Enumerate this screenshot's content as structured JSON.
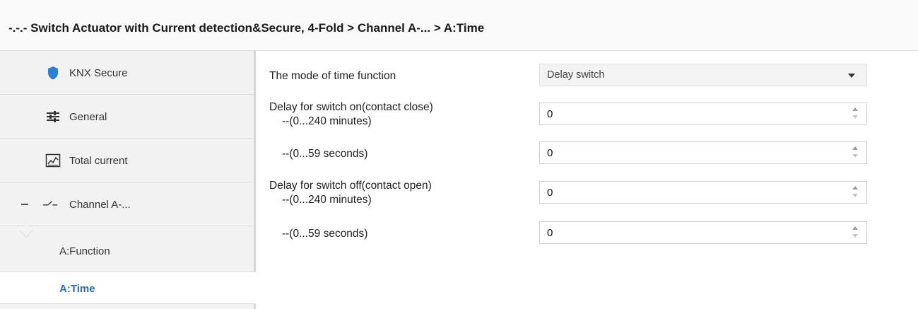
{
  "header": {
    "title": "-.-.- Switch Actuator with Current detection&Secure, 4-Fold > Channel A-... >  A:Time"
  },
  "sidebar": {
    "items": [
      {
        "label": "KNX Secure",
        "icon": "shield-icon"
      },
      {
        "label": "General",
        "icon": "sliders-icon"
      },
      {
        "label": "Total current",
        "icon": "chart-icon"
      },
      {
        "label": "Channel A-...",
        "icon": "switch-contact-icon",
        "expanded": true
      }
    ],
    "subitems": [
      {
        "label": "A:Function",
        "active": false
      },
      {
        "label": "A:Time",
        "active": true
      }
    ]
  },
  "params": {
    "mode": {
      "label": "The mode of time function",
      "value": "Delay switch"
    },
    "on_minutes": {
      "label": "Delay for switch on(contact close)",
      "sublabel": "--(0...240 minutes)",
      "value": "0"
    },
    "on_seconds": {
      "sublabel": "--(0...59 seconds)",
      "value": "0"
    },
    "off_minutes": {
      "label": "Delay for switch off(contact open)",
      "sublabel": "--(0...240 minutes)",
      "value": "0"
    },
    "off_seconds": {
      "sublabel": "--(0...59 seconds)",
      "value": "0"
    }
  },
  "colors": {
    "accent": "#2a6ab8",
    "sidebar_bg": "#f2f2f2"
  }
}
